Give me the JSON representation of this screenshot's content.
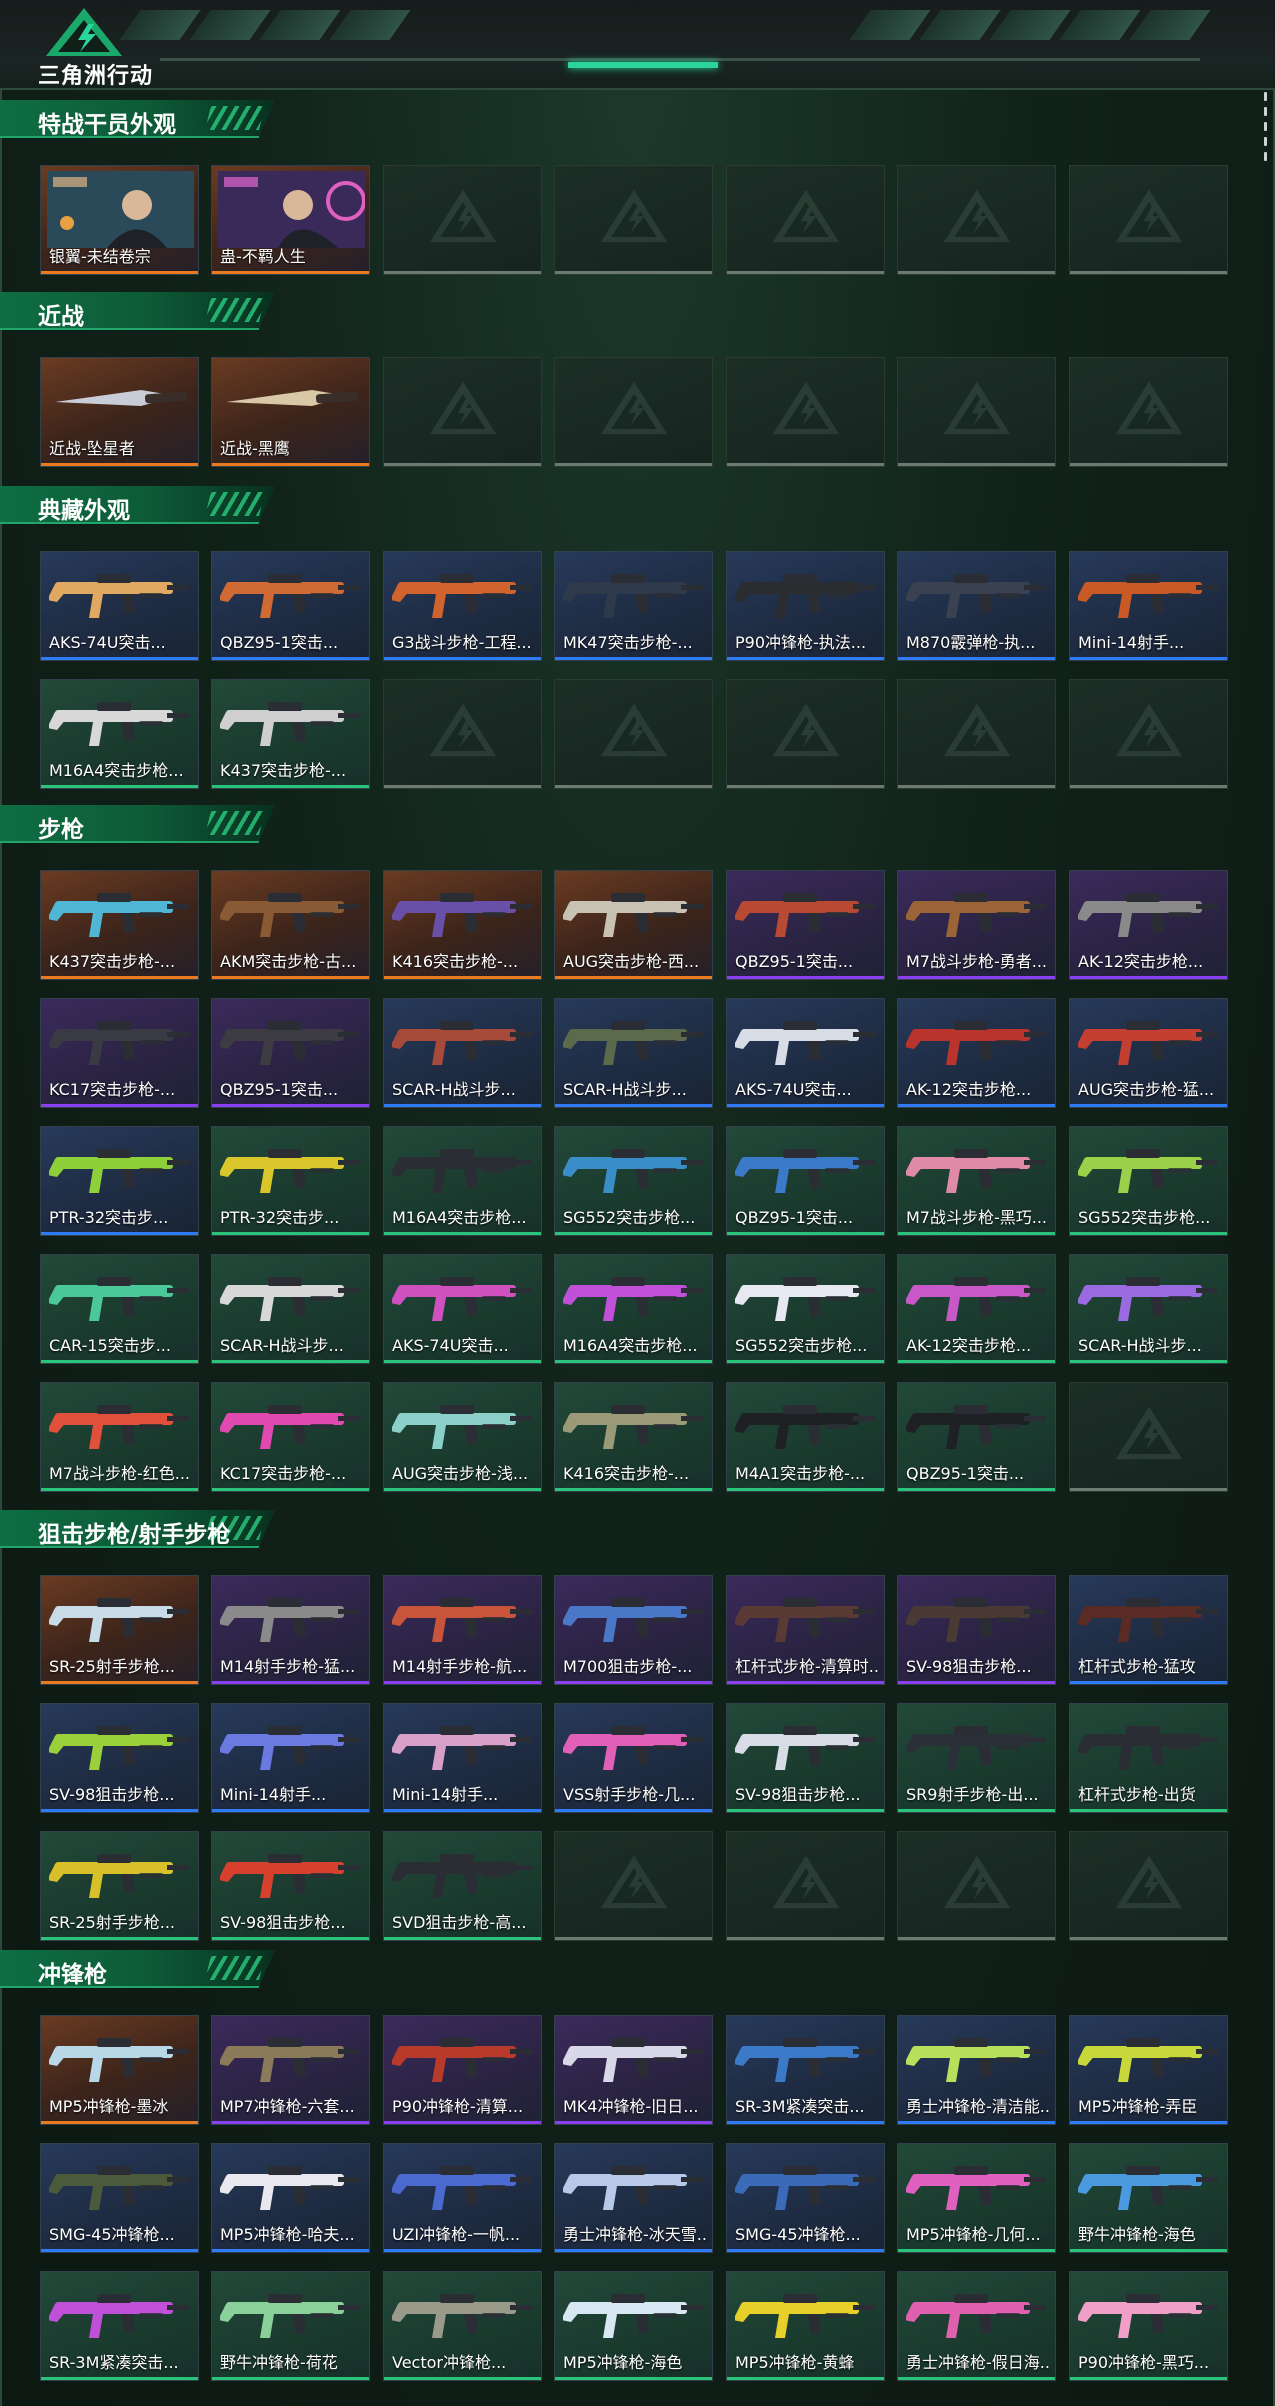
{
  "header": {
    "brand": "三角洲行动"
  },
  "colors": {
    "gold": "#e97b1e",
    "purple": "#8a3ff0",
    "blue": "#2f7af5",
    "green": "#29c37a",
    "accent": "#2bd49a"
  },
  "sections": [
    {
      "title": "特战干员外观",
      "items": [
        {
          "name": "银翼-未结卷宗",
          "rarity": "gold",
          "kind": "operator",
          "icon": "operator-portrait"
        },
        {
          "name": "蛊-不羁人生",
          "rarity": "gold",
          "kind": "operator",
          "icon": "operator-portrait"
        },
        {
          "empty": true
        },
        {
          "empty": true
        },
        {
          "empty": true
        },
        {
          "empty": true
        },
        {
          "empty": true
        }
      ]
    },
    {
      "title": "近战",
      "items": [
        {
          "name": "近战-坠星者",
          "rarity": "gold",
          "kind": "melee",
          "icon": "knife-icon"
        },
        {
          "name": "近战-黑鹰",
          "rarity": "gold",
          "kind": "melee",
          "icon": "knife-icon"
        },
        {
          "empty": true
        },
        {
          "empty": true
        },
        {
          "empty": true
        },
        {
          "empty": true
        },
        {
          "empty": true
        }
      ]
    },
    {
      "title": "典藏外观",
      "items": [
        {
          "name": "AKS-74U突击...",
          "rarity": "blue",
          "kind": "gun",
          "color": "#e0a860"
        },
        {
          "name": "QBZ95-1突击...",
          "rarity": "blue",
          "kind": "gun",
          "color": "#d06a34"
        },
        {
          "name": "G3战斗步枪-工程...",
          "rarity": "blue",
          "kind": "gun",
          "color": "#d0632e"
        },
        {
          "name": "MK47突击步枪-...",
          "rarity": "blue",
          "kind": "gun",
          "color": "#2e3a4a"
        },
        {
          "name": "P90冲锋枪-执法...",
          "rarity": "blue",
          "kind": "gun",
          "color": "#2a2c30"
        },
        {
          "name": "M870霰弹枪-执...",
          "rarity": "blue",
          "kind": "gun",
          "color": "#3a4150"
        },
        {
          "name": "Mini-14射手...",
          "rarity": "blue",
          "kind": "gun",
          "color": "#c95a26"
        },
        {
          "name": "M16A4突击步枪...",
          "rarity": "green",
          "kind": "gun",
          "color": "#d8d8d8"
        },
        {
          "name": "K437突击步枪-...",
          "rarity": "green",
          "kind": "gun",
          "color": "#cfcfcf"
        },
        {
          "empty": true
        },
        {
          "empty": true
        },
        {
          "empty": true
        },
        {
          "empty": true
        },
        {
          "empty": true
        }
      ]
    },
    {
      "title": "步枪",
      "items": [
        {
          "name": "K437突击步枪-...",
          "rarity": "gold",
          "kind": "gun",
          "color": "#4fb6d6"
        },
        {
          "name": "AKM突击步枪-古...",
          "rarity": "gold",
          "kind": "gun",
          "color": "#8a5a34"
        },
        {
          "name": "K416突击步枪-...",
          "rarity": "gold",
          "kind": "gun",
          "color": "#6a4fa8"
        },
        {
          "name": "AUG突击步枪-西...",
          "rarity": "gold",
          "kind": "gun",
          "color": "#c8c2b2"
        },
        {
          "name": "QBZ95-1突击...",
          "rarity": "purple",
          "kind": "gun",
          "color": "#b84a34"
        },
        {
          "name": "M7战斗步枪-勇者...",
          "rarity": "purple",
          "kind": "gun",
          "color": "#9a6436"
        },
        {
          "name": "AK-12突击步枪...",
          "rarity": "purple",
          "kind": "gun",
          "color": "#8a8a8a"
        },
        {
          "name": "KC17突击步枪-...",
          "rarity": "purple",
          "kind": "gun",
          "color": "#3a3a44"
        },
        {
          "name": "QBZ95-1突击...",
          "rarity": "purple",
          "kind": "gun",
          "color": "#3c3c42"
        },
        {
          "name": "SCAR-H战斗步...",
          "rarity": "blue",
          "kind": "gun",
          "color": "#a84a3a"
        },
        {
          "name": "SCAR-H战斗步...",
          "rarity": "blue",
          "kind": "gun",
          "color": "#5a6a4a"
        },
        {
          "name": "AKS-74U突击...",
          "rarity": "blue",
          "kind": "gun",
          "color": "#d8dce6"
        },
        {
          "name": "AK-12突击步枪...",
          "rarity": "blue",
          "kind": "gun",
          "color": "#b8342c"
        },
        {
          "name": "AUG突击步枪-猛...",
          "rarity": "blue",
          "kind": "gun",
          "color": "#c43e32"
        },
        {
          "name": "PTR-32突击步...",
          "rarity": "blue",
          "kind": "gun",
          "color": "#8ed03a"
        },
        {
          "name": "PTR-32突击步...",
          "rarity": "green",
          "kind": "gun",
          "color": "#d8c62a"
        },
        {
          "name": "M16A4突击步枪...",
          "rarity": "green",
          "kind": "gun",
          "color": "#2a2e34"
        },
        {
          "name": "SG552突击步枪...",
          "rarity": "green",
          "kind": "gun",
          "color": "#3a8ec8"
        },
        {
          "name": "QBZ95-1突击...",
          "rarity": "green",
          "kind": "gun",
          "color": "#3a7ac8"
        },
        {
          "name": "M7战斗步枪-黑巧...",
          "rarity": "green",
          "kind": "gun",
          "color": "#e08aa8"
        },
        {
          "name": "SG552突击步枪...",
          "rarity": "green",
          "kind": "gun",
          "color": "#9ad04a"
        },
        {
          "name": "CAR-15突击步...",
          "rarity": "green",
          "kind": "gun",
          "color": "#4ac89a"
        },
        {
          "name": "SCAR-H战斗步...",
          "rarity": "green",
          "kind": "gun",
          "color": "#d8d8d8"
        },
        {
          "name": "AKS-74U突击...",
          "rarity": "green",
          "kind": "gun",
          "color": "#d050c0"
        },
        {
          "name": "M16A4突击步枪...",
          "rarity": "green",
          "kind": "gun",
          "color": "#c050d8"
        },
        {
          "name": "SG552突击步枪...",
          "rarity": "green",
          "kind": "gun",
          "color": "#e8e8f2"
        },
        {
          "name": "AK-12突击步枪...",
          "rarity": "green",
          "kind": "gun",
          "color": "#c858c8"
        },
        {
          "name": "SCAR-H战斗步...",
          "rarity": "green",
          "kind": "gun",
          "color": "#9a6ae0"
        },
        {
          "name": "M7战斗步枪-红色...",
          "rarity": "green",
          "kind": "gun",
          "color": "#e0503a"
        },
        {
          "name": "KC17突击步枪-...",
          "rarity": "green",
          "kind": "gun",
          "color": "#e04ab0"
        },
        {
          "name": "AUG突击步枪-浅...",
          "rarity": "green",
          "kind": "gun",
          "color": "#8ad0c8"
        },
        {
          "name": "K416突击步枪-...",
          "rarity": "green",
          "kind": "gun",
          "color": "#9a9a78"
        },
        {
          "name": "M4A1突击步枪-...",
          "rarity": "green",
          "kind": "gun",
          "color": "#1e2024"
        },
        {
          "name": "QBZ95-1突击...",
          "rarity": "green",
          "kind": "gun",
          "color": "#1e2024"
        },
        {
          "empty": true
        }
      ]
    },
    {
      "title": "狙击步枪/射手步枪",
      "items": [
        {
          "name": "SR-25射手步枪...",
          "rarity": "gold",
          "kind": "gun",
          "color": "#c8dce8"
        },
        {
          "name": "M14射手步枪-猛...",
          "rarity": "purple",
          "kind": "gun",
          "color": "#8a8a8a"
        },
        {
          "name": "M14射手步枪-航...",
          "rarity": "purple",
          "kind": "gun",
          "color": "#c8543a"
        },
        {
          "name": "M700狙击步枪-...",
          "rarity": "purple",
          "kind": "gun",
          "color": "#4a78c8"
        },
        {
          "name": "杠杆式步枪-清算时...",
          "rarity": "purple",
          "kind": "gun",
          "color": "#5a3a34"
        },
        {
          "name": "SV-98狙击步枪...",
          "rarity": "purple",
          "kind": "gun",
          "color": "#4a3a34"
        },
        {
          "name": "杠杆式步枪-猛攻",
          "rarity": "blue",
          "kind": "gun",
          "color": "#5a2a24"
        },
        {
          "name": "SV-98狙击步枪...",
          "rarity": "blue",
          "kind": "gun",
          "color": "#9ad03a"
        },
        {
          "name": "Mini-14射手...",
          "rarity": "blue",
          "kind": "gun",
          "color": "#6a7ae0"
        },
        {
          "name": "Mini-14射手...",
          "rarity": "blue",
          "kind": "gun",
          "color": "#d8a0c8"
        },
        {
          "name": "VSS射手步枪-几...",
          "rarity": "blue",
          "kind": "gun",
          "color": "#e060b8"
        },
        {
          "name": "SV-98狙击步枪...",
          "rarity": "green",
          "kind": "gun",
          "color": "#d8dce6"
        },
        {
          "name": "SR9射手步枪-出...",
          "rarity": "green",
          "kind": "gun",
          "color": "#2a3038"
        },
        {
          "name": "杠杆式步枪-出货",
          "rarity": "green",
          "kind": "gun",
          "color": "#2a2e34"
        },
        {
          "name": "SR-25射手步枪...",
          "rarity": "green",
          "kind": "gun",
          "color": "#d8c02a"
        },
        {
          "name": "SV-98狙击步枪...",
          "rarity": "green",
          "kind": "gun",
          "color": "#d8402e"
        },
        {
          "name": "SVD狙击步枪-高...",
          "rarity": "green",
          "kind": "gun",
          "color": "#2a2e34"
        },
        {
          "empty": true
        },
        {
          "empty": true
        },
        {
          "empty": true
        },
        {
          "empty": true
        }
      ]
    },
    {
      "title": "冲锋枪",
      "items": [
        {
          "name": "MP5冲锋枪-墨冰",
          "rarity": "gold",
          "kind": "gun",
          "color": "#b8d8e8"
        },
        {
          "name": "MP7冲锋枪-六套...",
          "rarity": "purple",
          "kind": "gun",
          "color": "#8a7a5a"
        },
        {
          "name": "P90冲锋枪-清算...",
          "rarity": "purple",
          "kind": "gun",
          "color": "#b83a2a"
        },
        {
          "name": "MK4冲锋枪-旧日...",
          "rarity": "purple",
          "kind": "gun",
          "color": "#d8d8e8"
        },
        {
          "name": "SR-3M紧凑突击...",
          "rarity": "blue",
          "kind": "gun",
          "color": "#3a7ac8"
        },
        {
          "name": "勇士冲锋枪-清洁能...",
          "rarity": "blue",
          "kind": "gun",
          "color": "#b8e05a"
        },
        {
          "name": "MP5冲锋枪-弄臣",
          "rarity": "blue",
          "kind": "gun",
          "color": "#c8d83a"
        },
        {
          "name": "SMG-45冲锋枪...",
          "rarity": "blue",
          "kind": "gun",
          "color": "#4a5a3a"
        },
        {
          "name": "MP5冲锋枪-哈夫...",
          "rarity": "blue",
          "kind": "gun",
          "color": "#e8e8ee"
        },
        {
          "name": "UZI冲锋枪-一帆...",
          "rarity": "blue",
          "kind": "gun",
          "color": "#4a6ad0"
        },
        {
          "name": "勇士冲锋枪-冰天雪...",
          "rarity": "blue",
          "kind": "gun",
          "color": "#b8c8e8"
        },
        {
          "name": "SMG-45冲锋枪...",
          "rarity": "blue",
          "kind": "gun",
          "color": "#3a6ab8"
        },
        {
          "name": "MP5冲锋枪-几何...",
          "rarity": "green",
          "kind": "gun",
          "color": "#e060c0"
        },
        {
          "name": "野牛冲锋枪-海色",
          "rarity": "green",
          "kind": "gun",
          "color": "#4a9ae0"
        },
        {
          "name": "SR-3M紧凑突击...",
          "rarity": "green",
          "kind": "gun",
          "color": "#c050d8"
        },
        {
          "name": "野牛冲锋枪-荷花",
          "rarity": "green",
          "kind": "gun",
          "color": "#8ad09a"
        },
        {
          "name": "Vector冲锋枪...",
          "rarity": "green",
          "kind": "gun",
          "color": "#9a9a8a"
        },
        {
          "name": "MP5冲锋枪-海色",
          "rarity": "green",
          "kind": "gun",
          "color": "#d8e8f2"
        },
        {
          "name": "MP5冲锋枪-黄蜂",
          "rarity": "green",
          "kind": "gun",
          "color": "#e8d02a"
        },
        {
          "name": "勇士冲锋枪-假日海...",
          "rarity": "green",
          "kind": "gun",
          "color": "#e060b0"
        },
        {
          "name": "P90冲锋枪-黑巧...",
          "rarity": "green",
          "kind": "gun",
          "color": "#f0a0c8"
        }
      ]
    }
  ]
}
